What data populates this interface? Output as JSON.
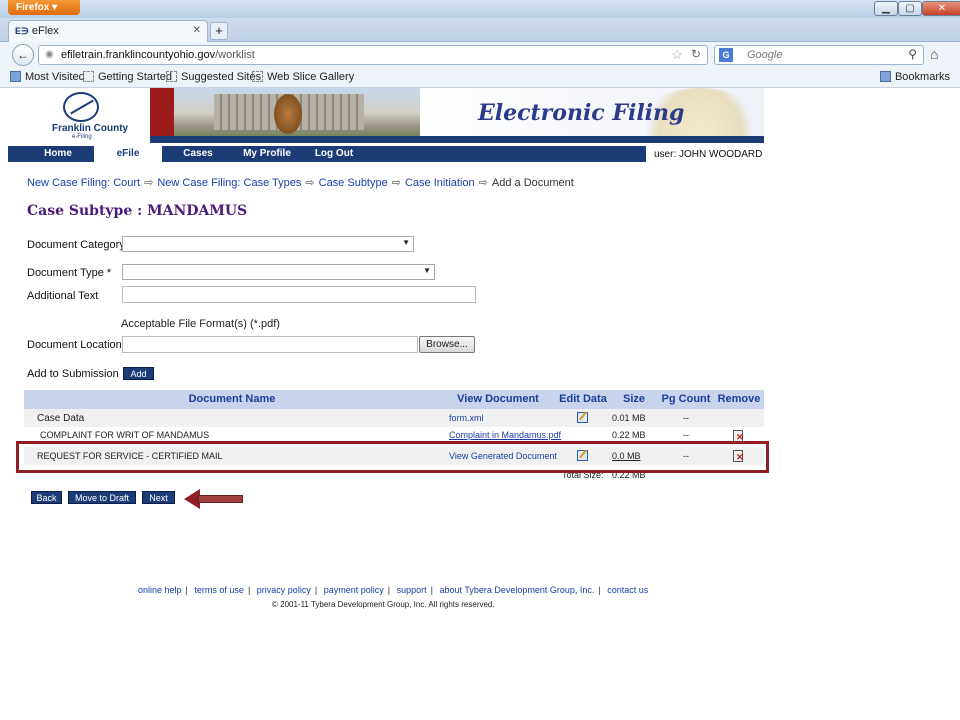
{
  "browser": {
    "app_button": "Firefox",
    "tab_title": "eFlex",
    "url_host": "efiletrain.franklincountyohio.gov",
    "url_path": "/worklist",
    "search_placeholder": "Google",
    "bookmarks": [
      "Most Visited",
      "Getting Started",
      "Suggested Sites",
      "Web Slice Gallery"
    ],
    "bookmarks_menu": "Bookmarks"
  },
  "site": {
    "logo_text": "Franklin County",
    "logo_sub": "e-Filing",
    "banner_title": "Electronic Filing",
    "nav": [
      "Home",
      "eFile",
      "Cases",
      "My Profile",
      "Log Out"
    ],
    "active_nav": "eFile",
    "user_label": "user: JOHN WOODARD"
  },
  "breadcrumb": {
    "items": [
      "New Case Filing: Court",
      "New Case Filing: Case Types",
      "Case Subtype",
      "Case Initiation"
    ],
    "current": "Add a Document"
  },
  "heading": "Case Subtype : MANDAMUS",
  "form": {
    "doc_category_label": "Document Category",
    "doc_category_value": "",
    "doc_type_label": "Document Type *",
    "doc_type_value": "",
    "additional_text_label": "Additional Text",
    "additional_text_value": "",
    "format_note": "Acceptable File Format(s) (*.pdf)",
    "doc_location_label": "Document Location",
    "doc_location_value": "",
    "browse_label": "Browse...",
    "add_to_submission_label": "Add to Submission",
    "add_button": "Add"
  },
  "documents": {
    "headers": [
      "Document Name",
      "View Document",
      "Edit Data",
      "Size",
      "Pg Count",
      "Remove"
    ],
    "rows": [
      {
        "name": "Case Data",
        "view": "form.xml",
        "size": "0.01 MB",
        "pages": "--"
      },
      {
        "name": "COMPLAINT FOR WRIT OF MANDAMUS",
        "view": "Complaint in Mandamus.pdf",
        "size": "0.22 MB",
        "pages": "--"
      },
      {
        "name": "REQUEST FOR SERVICE - CERTIFIED MAIL",
        "view": "View Generated Document",
        "size": "0.0 MB",
        "pages": "--"
      }
    ],
    "total_label": "Total Size:",
    "total_value": "0.22 MB"
  },
  "actions": {
    "back": "Back",
    "move_to_draft": "Move to Draft",
    "next": "Next"
  },
  "footer": {
    "links": [
      "online help",
      "terms of use",
      "privacy policy",
      "payment policy",
      "support",
      "about Tybera Development Group, Inc.",
      "contact us"
    ],
    "copyright": "© 2001-11 Tybera Development Group, Inc. All rights reserved."
  },
  "colors": {
    "navy": "#1c3c78",
    "link": "#1a3ea8",
    "heading_purple": "#4b1a7a",
    "highlight_red": "#8f1f24"
  }
}
